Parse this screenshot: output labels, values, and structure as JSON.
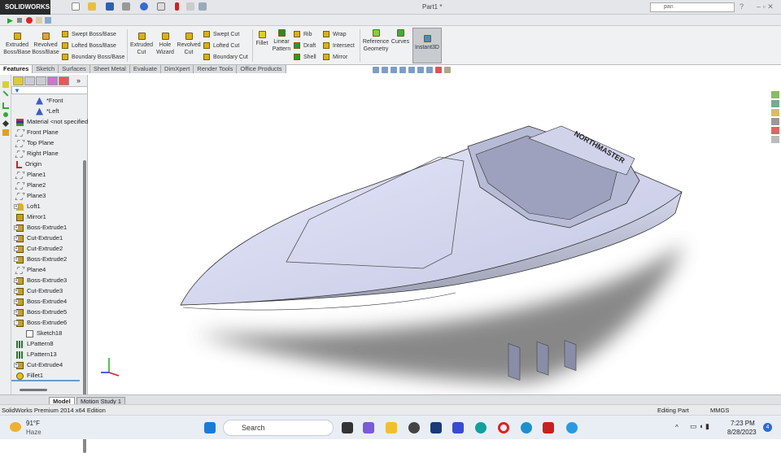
{
  "app": {
    "logo": "SOLIDWORKS",
    "doc_title": "Part1 *",
    "search_value": "pan"
  },
  "ribbon": {
    "extruded_boss": "Extruded Boss/Base",
    "revolved_boss": "Revolved Boss/Base",
    "swept_boss": "Swept Boss/Base",
    "lofted_boss": "Lofted Boss/Base",
    "boundary_boss": "Boundary Boss/Base",
    "extruded_cut": "Extruded Cut",
    "hole_wizard": "Hole Wizard",
    "revolved_cut": "Revolved Cut",
    "swept_cut": "Swept Cut",
    "lofted_cut": "Lofted Cut",
    "boundary_cut": "Boundary Cut",
    "fillet": "Fillet",
    "linear_pattern": "Linear Pattern",
    "rib": "Rib",
    "draft": "Draft",
    "shell": "Shell",
    "wrap": "Wrap",
    "intersect": "Intersect",
    "mirror": "Mirror",
    "reference_geometry": "Reference Geometry",
    "curves": "Curves",
    "instant3d": "Instant3D"
  },
  "tabs": [
    "Features",
    "Sketch",
    "Surfaces",
    "Sheet Metal",
    "Evaluate",
    "DimXpert",
    "Render Tools",
    "Office Products"
  ],
  "tree": [
    {
      "label": "*Front",
      "icon": "view",
      "indent": 2
    },
    {
      "label": "*Left",
      "icon": "view",
      "indent": 2
    },
    {
      "label": "Material <not specified>",
      "icon": "mat"
    },
    {
      "label": "Front Plane",
      "icon": "plane"
    },
    {
      "label": "Top Plane",
      "icon": "plane"
    },
    {
      "label": "Right Plane",
      "icon": "plane"
    },
    {
      "label": "Origin",
      "icon": "org"
    },
    {
      "label": "Plane1",
      "icon": "plane"
    },
    {
      "label": "Plane2",
      "icon": "plane"
    },
    {
      "label": "Plane3",
      "icon": "plane"
    },
    {
      "label": "Loft1",
      "icon": "loft",
      "exp": "+"
    },
    {
      "label": "Mirror1",
      "icon": "feat"
    },
    {
      "label": "Boss-Extrude1",
      "icon": "feat",
      "exp": "+"
    },
    {
      "label": "Cut-Extrude1",
      "icon": "feat",
      "exp": "+"
    },
    {
      "label": "Cut-Extrude2",
      "icon": "feat",
      "exp": "+"
    },
    {
      "label": "Boss-Extrude2",
      "icon": "feat",
      "exp": "+"
    },
    {
      "label": "Plane4",
      "icon": "plane"
    },
    {
      "label": "Boss-Extrude3",
      "icon": "feat",
      "exp": "+"
    },
    {
      "label": "Cut-Extrude3",
      "icon": "feat",
      "exp": "+"
    },
    {
      "label": "Boss-Extrude4",
      "icon": "feat",
      "exp": "+"
    },
    {
      "label": "Boss-Extrude5",
      "icon": "feat",
      "exp": "+"
    },
    {
      "label": "Boss-Extrude6",
      "icon": "feat",
      "exp": "-"
    },
    {
      "label": "Sketch18",
      "icon": "sk",
      "indent": 1
    },
    {
      "label": "LPattern8",
      "icon": "pat"
    },
    {
      "label": "LPattern13",
      "icon": "pat"
    },
    {
      "label": "Cut-Extrude4",
      "icon": "feat",
      "exp": "+"
    },
    {
      "label": "Fillet1",
      "icon": "fil"
    }
  ],
  "model": {
    "brand_text": "NORTHMASTER"
  },
  "bottom_tabs": {
    "model": "Model",
    "motion": "Motion Study 1"
  },
  "status": {
    "edition": "SolidWorks Premium 2014 x64 Edition",
    "mode": "Editing Part",
    "units": "MMGS"
  },
  "taskbar": {
    "temp": "91°F",
    "weather": "Haze",
    "search": "Search",
    "time": "7:23 PM",
    "date": "8/28/2023",
    "notif": "4"
  }
}
